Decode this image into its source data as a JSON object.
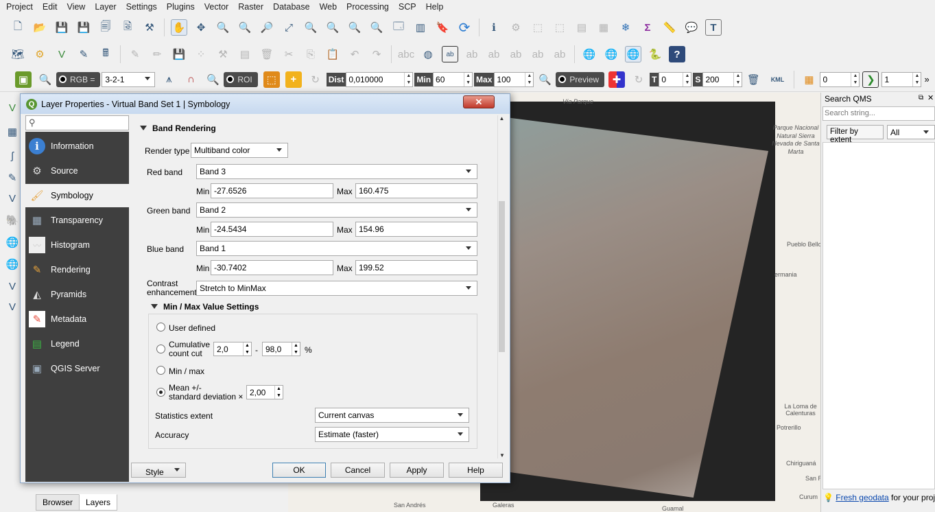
{
  "menubar": {
    "items": [
      "Project",
      "Edit",
      "View",
      "Layer",
      "Settings",
      "Plugins",
      "Vector",
      "Raster",
      "Database",
      "Web",
      "Processing",
      "SCP",
      "Help"
    ]
  },
  "toolbar3": {
    "rgb_label": "RGB =",
    "rgb_value": "3-2-1",
    "roi_label": "ROI",
    "dist_label": "Dist",
    "dist_value": "0,010000",
    "min_label": "Min",
    "min_value": "60",
    "max_label": "Max",
    "max_value": "100",
    "preview_label": "Preview",
    "t_label": "T",
    "t_value": "0",
    "s_label": "S",
    "s_value": "200",
    "kml_label": "KML",
    "val1": "0",
    "val2": "1",
    "more": "»"
  },
  "map": {
    "labels": [
      "Vía Parque",
      "Parque Nacional Natural Sierra Nevada de Santa Marta",
      "Pueblo Bello",
      "ermania",
      "La Loma de Calenturas",
      "Potrerillo",
      "Chiriguaná",
      "San R",
      "Curum",
      "San Andrés",
      "Galeras",
      "Guamal"
    ]
  },
  "qms": {
    "title": "Search QMS",
    "search_placeholder": "Search string...",
    "filter_button": "Filter by extent",
    "filter_value": "All",
    "footer_link": "Fresh geodata",
    "footer_text": " for your project"
  },
  "bottom_tabs": [
    "Browser",
    "Layers"
  ],
  "dialog": {
    "title": "Layer Properties - Virtual Band Set 1 | Symbology",
    "close": "✕",
    "nav": [
      {
        "label": "Information",
        "icon": "info-icon",
        "glyph": "i",
        "color": "#3b7fd1"
      },
      {
        "label": "Source",
        "icon": "gear-wrench-icon",
        "glyph": "⚙",
        "color": "#ddd"
      },
      {
        "label": "Symbology",
        "icon": "paintbrush-icon",
        "glyph": "🖌",
        "color": "#e6a23c"
      },
      {
        "label": "Transparency",
        "icon": "transparency-icon",
        "glyph": "▦",
        "color": "#9ab"
      },
      {
        "label": "Histogram",
        "icon": "histogram-icon",
        "glyph": "〰",
        "color": "#ccc"
      },
      {
        "label": "Rendering",
        "icon": "brush-icon",
        "glyph": "✎",
        "color": "#e6a23c"
      },
      {
        "label": "Pyramids",
        "icon": "pyramid-icon",
        "glyph": "◭",
        "color": "#ddd"
      },
      {
        "label": "Metadata",
        "icon": "metadata-icon",
        "glyph": "✎",
        "color": "#e74c3c"
      },
      {
        "label": "Legend",
        "icon": "legend-icon",
        "glyph": "▤",
        "color": "#3cb043"
      },
      {
        "label": "QGIS Server",
        "icon": "server-icon",
        "glyph": "▣",
        "color": "#9ab"
      }
    ],
    "band_rendering": {
      "header": "Band Rendering",
      "render_type_label": "Render type",
      "render_type": "Multiband color",
      "red_label": "Red band",
      "red_band": "Band 3",
      "red_min": "-27.6526",
      "red_max": "160.475",
      "green_label": "Green band",
      "green_band": "Band 2",
      "green_min": "-24.5434",
      "green_max": "154.96",
      "blue_label": "Blue band",
      "blue_band": "Band 1",
      "blue_min": "-30.7402",
      "blue_max": "199.52",
      "min_label": "Min",
      "max_label": "Max",
      "contrast_label_1": "Contrast",
      "contrast_label_2": "enhancement",
      "contrast_value": "Stretch to MinMax"
    },
    "minmax": {
      "header": "Min / Max Value Settings",
      "user_defined": "User defined",
      "cumulative_1": "Cumulative",
      "cumulative_2": "count cut",
      "cum_low": "2,0",
      "cum_dash": "-",
      "cum_high": "98,0",
      "cum_pct": "%",
      "minmax": "Min / max",
      "mean_1": "Mean +/-",
      "mean_2": "standard deviation ×",
      "mean_value": "2,00",
      "selected": "mean",
      "stats_label": "Statistics extent",
      "stats_value": "Current canvas",
      "accuracy_label": "Accuracy",
      "accuracy_value": "Estimate (faster)"
    },
    "buttons": {
      "style": "Style",
      "ok": "OK",
      "cancel": "Cancel",
      "apply": "Apply",
      "help": "Help"
    }
  }
}
